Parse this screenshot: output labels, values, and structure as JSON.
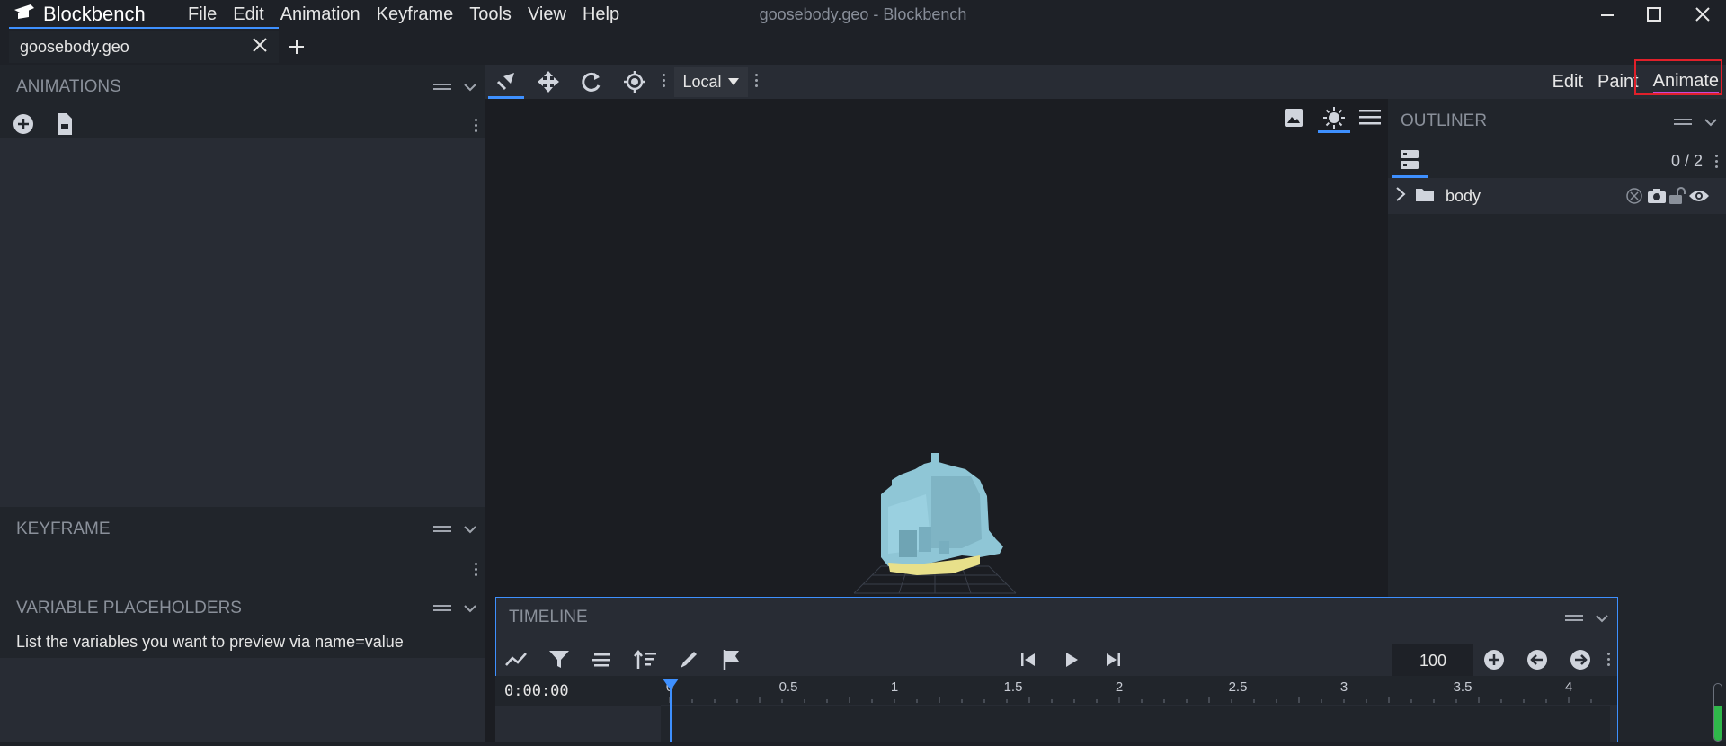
{
  "app": {
    "name": "Blockbench",
    "window_title": "goosebody.geo - Blockbench",
    "menu": [
      "File",
      "Edit",
      "Animation",
      "Keyframe",
      "Tools",
      "View",
      "Help"
    ]
  },
  "tabs": [
    {
      "label": "goosebody.geo"
    }
  ],
  "toolbar": {
    "transform_space": "Local",
    "modes": [
      "Edit",
      "Paint",
      "Animate"
    ],
    "active_mode": "Animate"
  },
  "panels": {
    "animations": {
      "title": "ANIMATIONS"
    },
    "keyframe": {
      "title": "KEYFRAME"
    },
    "variable_placeholders": {
      "title": "VARIABLE PLACEHOLDERS",
      "hint": "List the variables you want to preview via name=value"
    },
    "outliner": {
      "title": "OUTLINER",
      "count": "0 / 2",
      "items": [
        {
          "label": "body"
        }
      ]
    }
  },
  "timeline": {
    "title": "TIMELINE",
    "timecode": "0:00:00",
    "fps": "100",
    "ruler_labels": [
      "0",
      "0.5",
      "1",
      "1.5",
      "2",
      "2.5",
      "3",
      "3.5",
      "4"
    ]
  },
  "colors": {
    "accent": "#3e90ff",
    "highlight_box": "#e0202a",
    "model_body": "#8fc6d6",
    "model_beak": "#e8e08a"
  }
}
